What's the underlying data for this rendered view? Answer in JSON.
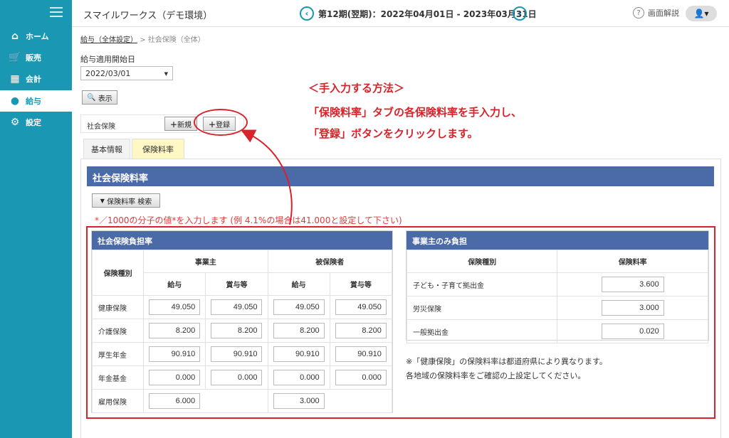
{
  "sidebar": {
    "items": [
      {
        "label": "ホーム",
        "icon": "home-icon"
      },
      {
        "label": "販売",
        "icon": "cart-icon"
      },
      {
        "label": "会計",
        "icon": "calculator-icon"
      },
      {
        "label": "給与",
        "icon": "money-bag-icon"
      },
      {
        "label": "設定",
        "icon": "gear-icon"
      }
    ],
    "active": "給与"
  },
  "header": {
    "company": "スマイルワークス（デモ環境）",
    "period": "第12期(翌期)：2022年04月01日 - 2023年03月31日",
    "help_label": "画面解説"
  },
  "breadcrumb": {
    "link": "給与（全体設定）",
    "sep": ">",
    "current": "社会保険（全体）"
  },
  "start_date": {
    "label": "給与適用開始日",
    "value": "2022/03/01"
  },
  "buttons": {
    "show": "表示",
    "new": "新規",
    "register": "登録",
    "search": "保険料率 検索"
  },
  "insurance_label": "社会保険",
  "tabs": [
    {
      "label": "基本情報"
    },
    {
      "label": "保険料率"
    }
  ],
  "section_title": "社会保険料率",
  "note_red": "*／1000の分子の値*を入力します (例 4.1%の場合は41.000と設定して下さい)",
  "burden_table": {
    "title": "社会保険負担率",
    "type_header": "保険種別",
    "employer_header": "事業主",
    "insured_header": "被保険者",
    "sub_headers": [
      "給与",
      "賞与等",
      "給与",
      "賞与等"
    ],
    "rows": [
      {
        "name": "健康保険",
        "values": [
          "49.050",
          "49.050",
          "49.050",
          "49.050"
        ]
      },
      {
        "name": "介護保険",
        "values": [
          "8.200",
          "8.200",
          "8.200",
          "8.200"
        ]
      },
      {
        "name": "厚生年金",
        "values": [
          "90.910",
          "90.910",
          "90.910",
          "90.910"
        ]
      },
      {
        "name": "年金基金",
        "values": [
          "0.000",
          "0.000",
          "0.000",
          "0.000"
        ]
      }
    ],
    "employment": {
      "name": "雇用保険",
      "employer": "6.000",
      "insured": "3.000"
    }
  },
  "employer_table": {
    "title": "事業主のみ負担",
    "type_header": "保険種別",
    "rate_header": "保険料率",
    "rows": [
      {
        "name": "子ども・子育て拠出金",
        "value": "3.600"
      },
      {
        "name": "労災保険",
        "value": "3.000"
      },
      {
        "name": "一般拠出金",
        "value": "0.020"
      }
    ]
  },
  "note_lines": [
    "※「健康保険」の保険料率は都道府県により異なります。",
    "各地域の保険料率をご確認の上設定してください。"
  ],
  "annotation": {
    "title": "＜手入力する方法＞",
    "line1": "「保険料率」タブの各保険料率を手入力し、",
    "line2": "「登録」ボタンをクリックします。"
  },
  "colors": {
    "sidebar": "#1a98b3",
    "section_header": "#4b6aa8",
    "active_tab": "#fff7c4",
    "annotation": "#d8232a"
  }
}
